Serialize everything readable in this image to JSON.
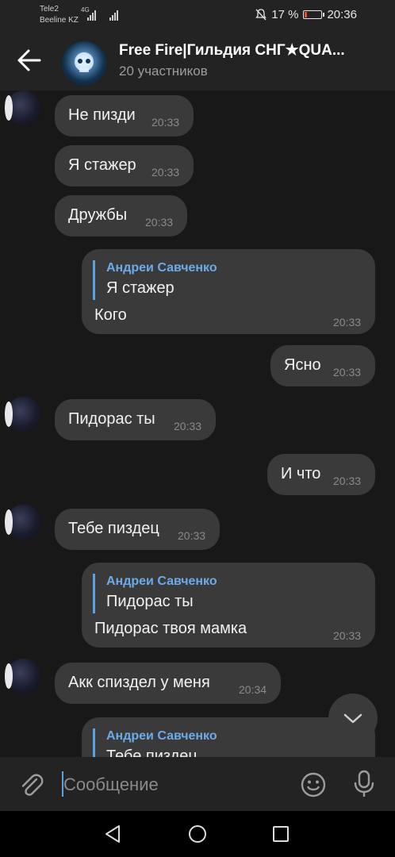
{
  "status": {
    "carrier1": "Tele2",
    "carrier2": "Beeline KZ",
    "net": "4G",
    "battery": "17 %",
    "battery_level": 0.17,
    "time": "20:36"
  },
  "header": {
    "title": "Free Fire|Гильдия СНГ★QUA...",
    "subtitle": "20 участников"
  },
  "messages": [
    {
      "text": "Не пизди",
      "time": "20:33"
    },
    {
      "text": "Я стажер",
      "time": "20:33"
    },
    {
      "text": "Дружбы",
      "time": "20:33"
    },
    {
      "reply_name": "Андреи Савченко",
      "reply_text": "Я стажер",
      "text": "Кого",
      "time": "20:33"
    },
    {
      "text": "Ясно",
      "time": "20:33"
    },
    {
      "text": "Пидорас ты",
      "time": "20:33"
    },
    {
      "text": "И что",
      "time": "20:33"
    },
    {
      "text": "Тебе пиздец",
      "time": "20:33"
    },
    {
      "reply_name": "Андреи Савченко",
      "reply_text": "Пидорас ты",
      "text": "Пидорас твоя мамка",
      "time": "20:33"
    },
    {
      "text": "Акк спиздел у меня",
      "time": "20:34"
    },
    {
      "reply_name": "Андреи Савченко",
      "reply_text": "Тебе пиздец"
    }
  ],
  "input": {
    "placeholder": "Сообщение"
  },
  "icons": [
    "back-arrow-icon",
    "attach-icon",
    "emoji-icon",
    "microphone-icon",
    "chevron-down-icon",
    "nav-back-icon",
    "nav-home-icon",
    "nav-recents-icon"
  ]
}
